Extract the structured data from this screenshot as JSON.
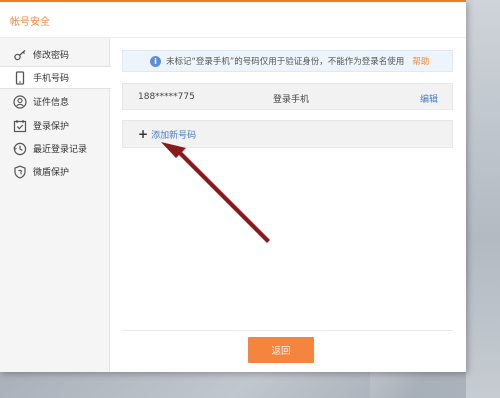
{
  "dialog": {
    "title": "帐号安全"
  },
  "sidebar": {
    "items": [
      {
        "label": "修改密码",
        "icon": "key-icon"
      },
      {
        "label": "手机号码",
        "icon": "phone-icon",
        "active": true
      },
      {
        "label": "证件信息",
        "icon": "id-card-icon"
      },
      {
        "label": "登录保护",
        "icon": "calendar-check-icon"
      },
      {
        "label": "最近登录记录",
        "icon": "clock-icon"
      },
      {
        "label": "微盾保护",
        "icon": "shield-icon"
      }
    ]
  },
  "notice": {
    "text": "未标记“登录手机”的号码仅用于验证身份，不能作为登录名使用",
    "help": "帮助"
  },
  "phone_row": {
    "number": "188*****775",
    "tag": "登录手机",
    "edit": "编辑"
  },
  "add_row": {
    "plus": "+",
    "label": "添加新号码"
  },
  "footer": {
    "back": "返回"
  },
  "colors": {
    "accent": "#f5843f",
    "title": "#f08a3c",
    "link": "#4a7ec7",
    "annotation_arrow": "#8b1a1a"
  }
}
